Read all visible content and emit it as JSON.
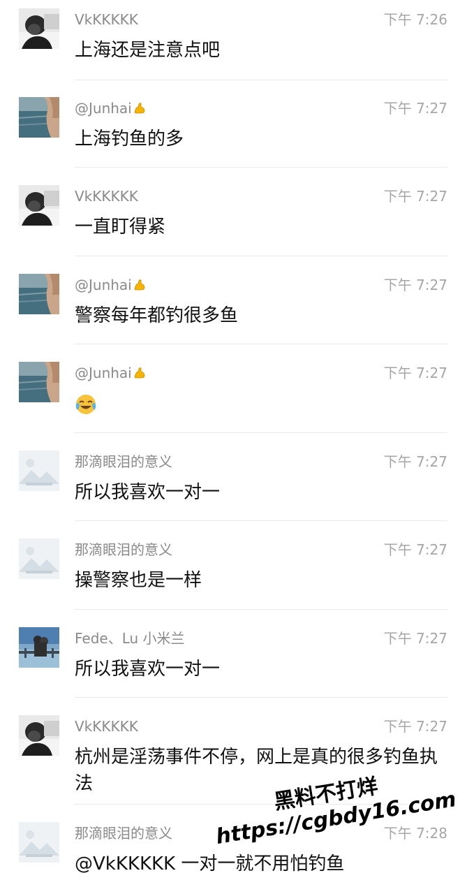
{
  "messages": [
    {
      "sender": "VkKKKKK",
      "avatar": "person-portrait",
      "time": "下午 7:26",
      "text": "上海还是注意点吧",
      "emoji": false,
      "flex": false
    },
    {
      "sender": "@Junhai",
      "avatar": "sea-photo",
      "time": "下午 7:27",
      "text": "上海钓鱼的多",
      "emoji": false,
      "flex": true
    },
    {
      "sender": "VkKKKKK",
      "avatar": "person-portrait",
      "time": "下午 7:27",
      "text": "一直盯得紧",
      "emoji": false,
      "flex": false
    },
    {
      "sender": "@Junhai",
      "avatar": "sea-photo",
      "time": "下午 7:27",
      "text": "警察每年都钓很多鱼",
      "emoji": false,
      "flex": true
    },
    {
      "sender": "@Junhai",
      "avatar": "sea-photo",
      "time": "下午 7:27",
      "text": "",
      "emoji": true,
      "flex": true
    },
    {
      "sender": "那滴眼泪的意义",
      "avatar": "placeholder-landscape",
      "time": "下午 7:27",
      "text": "所以我喜欢一对一",
      "emoji": false,
      "flex": false
    },
    {
      "sender": "那滴眼泪的意义",
      "avatar": "placeholder-landscape",
      "time": "下午 7:27",
      "text": "操警察也是一样",
      "emoji": false,
      "flex": false
    },
    {
      "sender": "Fede、Lu 小米兰",
      "avatar": "travel-photo",
      "time": "下午 7:27",
      "text": "所以我喜欢一对一",
      "emoji": false,
      "flex": false
    },
    {
      "sender": "VkKKKKK",
      "avatar": "person-portrait",
      "time": "下午 7:27",
      "text": "杭州是淫荡事件不停，网上是真的很多钓鱼执法",
      "emoji": false,
      "flex": false
    },
    {
      "sender": "那滴眼泪的意义",
      "avatar": "placeholder-landscape",
      "time": "下午 7:28",
      "text": "@VkKKKKK 一对一就不用怕钓鱼",
      "emoji": false,
      "flex": false
    }
  ],
  "watermark": {
    "line1": "黑料不打烊",
    "line2": "https://cgbdy16.com"
  },
  "colors": {
    "sender": "#8a8a8a",
    "time": "#a6a6a6",
    "text": "#111111",
    "divider": "#e9e9e9"
  }
}
